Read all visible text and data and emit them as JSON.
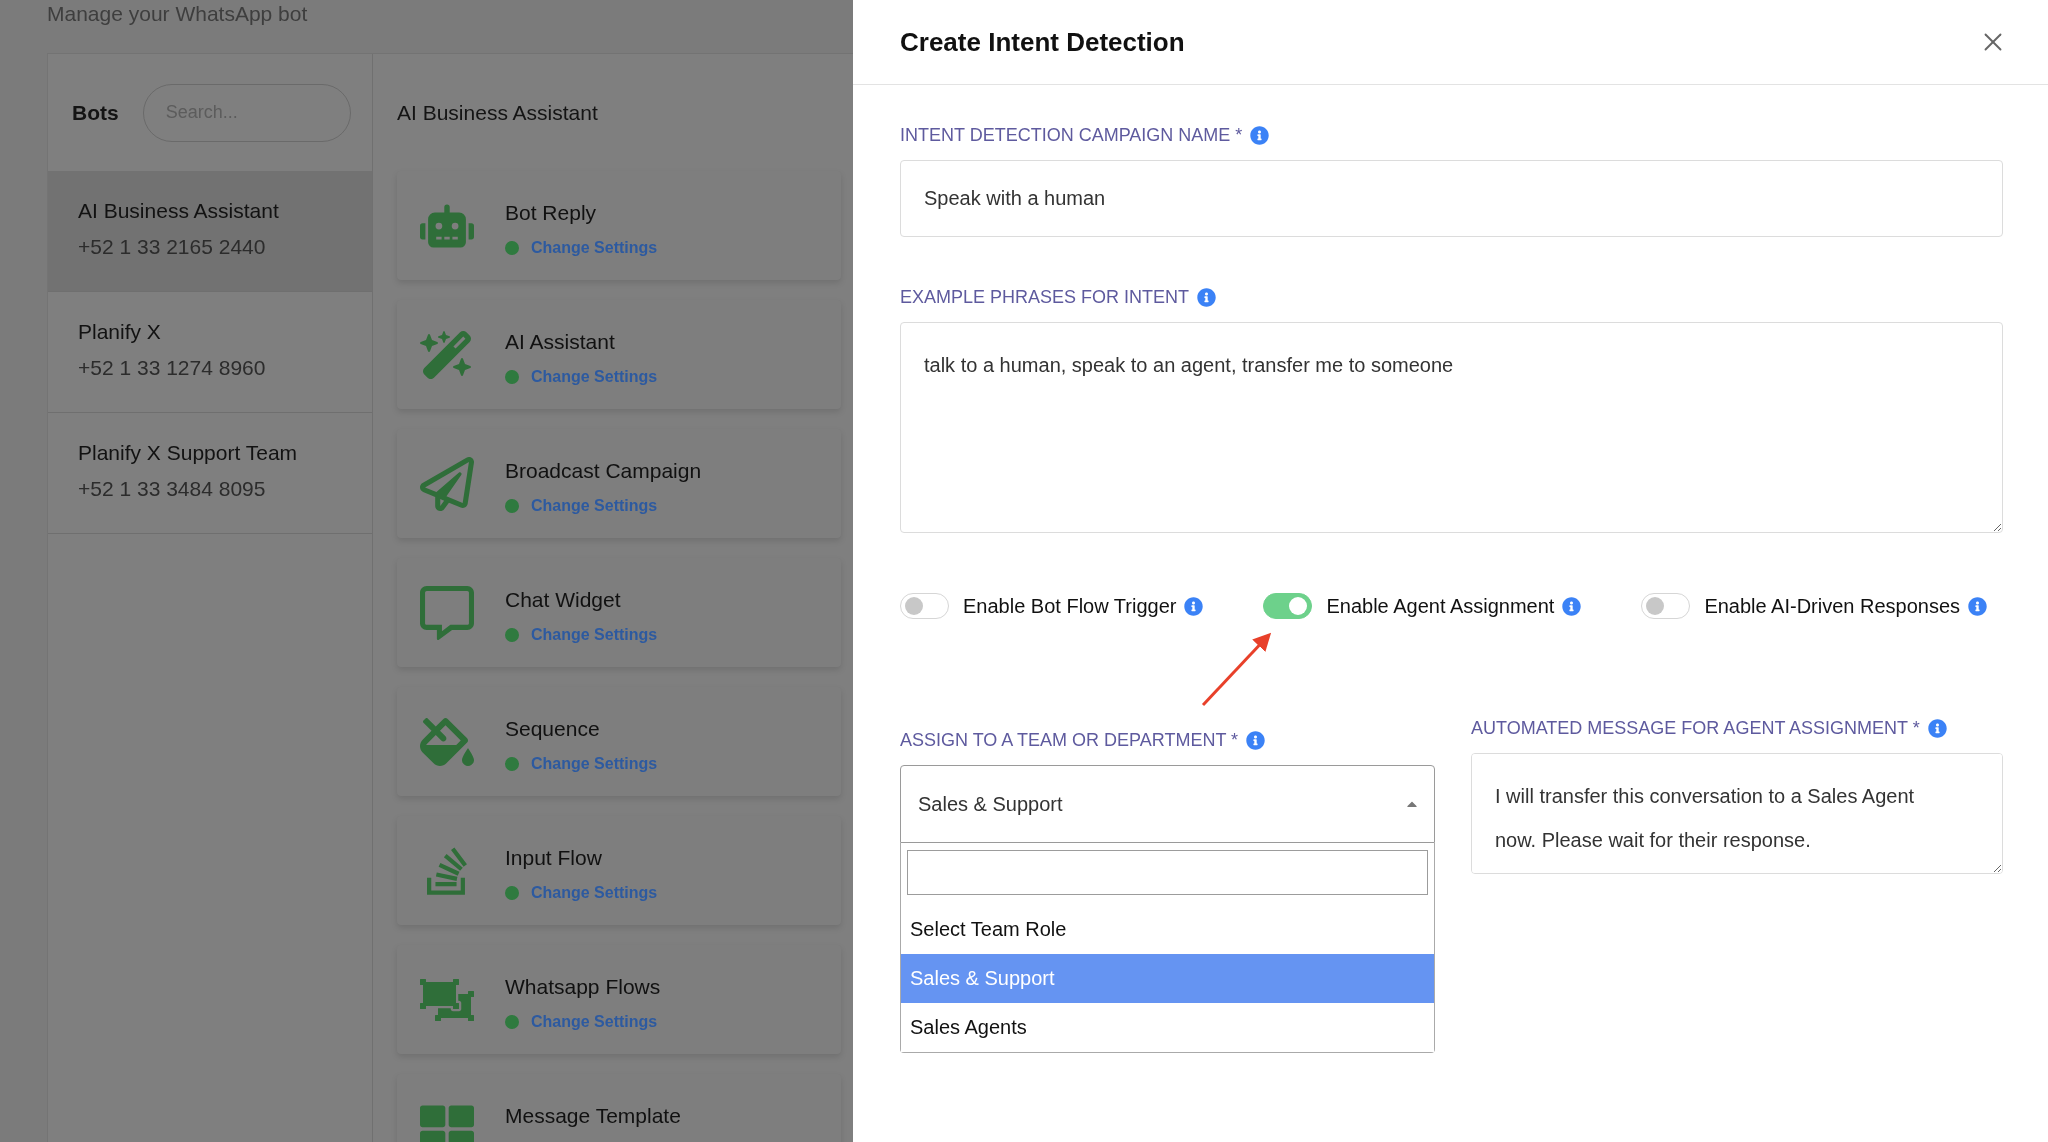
{
  "page": {
    "subtitle": "Manage your WhatsApp bot"
  },
  "bots": {
    "title": "Bots",
    "search_placeholder": "Search...",
    "items": [
      {
        "name": "AI Business Assistant",
        "phone": "+52 1 33 2165 2440",
        "selected": true
      },
      {
        "name": "Planify X",
        "phone": "+52 1 33 1274 8960",
        "selected": false
      },
      {
        "name": "Planify X Support Team",
        "phone": "+52 1 33 3484 8095",
        "selected": false
      }
    ]
  },
  "features": {
    "title": "AI Business Assistant",
    "items": [
      {
        "name": "Bot Reply",
        "link": "Change Settings"
      },
      {
        "name": "AI Assistant",
        "link": "Change Settings"
      },
      {
        "name": "Broadcast Campaign",
        "link": "Change Settings"
      },
      {
        "name": "Chat Widget",
        "link": "Change Settings"
      },
      {
        "name": "Sequence",
        "link": "Change Settings"
      },
      {
        "name": "Input Flow",
        "link": "Change Settings"
      },
      {
        "name": "Whatsapp Flows",
        "link": "Change Settings"
      },
      {
        "name": "Message Template"
      }
    ]
  },
  "drawer": {
    "title": "Create Intent Detection",
    "campaign_name": {
      "label": "INTENT DETECTION CAMPAIGN NAME *",
      "value": "Speak with a human"
    },
    "example_phrases": {
      "label": "EXAMPLE PHRASES FOR INTENT",
      "value": "talk to a human, speak to an agent, transfer me to someone"
    },
    "toggles": [
      {
        "label": "Enable Bot Flow Trigger",
        "on": false
      },
      {
        "label": "Enable Agent Assignment",
        "on": true
      },
      {
        "label": "Enable AI-Driven Responses",
        "on": false
      }
    ],
    "assign": {
      "label": "ASSIGN TO A TEAM OR DEPARTMENT *",
      "value": "Sales & Support",
      "expanded": true,
      "options": [
        {
          "label": "Select Team Role",
          "selected": false
        },
        {
          "label": "Sales & Support",
          "selected": true
        },
        {
          "label": "Sales Agents",
          "selected": false
        }
      ]
    },
    "message": {
      "label": "AUTOMATED MESSAGE FOR AGENT ASSIGNMENT *",
      "value": "I will transfer this conversation to a Sales Agent now. Please wait for their response."
    }
  }
}
